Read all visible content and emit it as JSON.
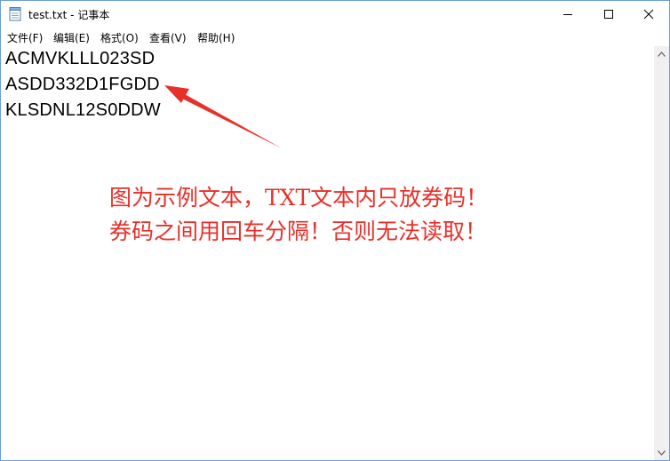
{
  "window": {
    "title": "test.txt - 记事本",
    "icon": "notepad-icon"
  },
  "controls": {
    "minimize_icon": "minimize-icon",
    "maximize_icon": "maximize-icon",
    "close_icon": "close-icon"
  },
  "menu": {
    "items": [
      {
        "label": "文件(F)"
      },
      {
        "label": "编辑(E)"
      },
      {
        "label": "格式(O)"
      },
      {
        "label": "查看(V)"
      },
      {
        "label": "帮助(H)"
      }
    ]
  },
  "document": {
    "lines": [
      "ACMVKLLL023SD",
      "ASDD332D1FGDD",
      "KLSDNL12S0DDW"
    ]
  },
  "annotation": {
    "line1": "图为示例文本，TXT文本内只放券码！",
    "line2": "券码之间用回车分隔！否则无法读取！",
    "color": "#e8302a"
  }
}
